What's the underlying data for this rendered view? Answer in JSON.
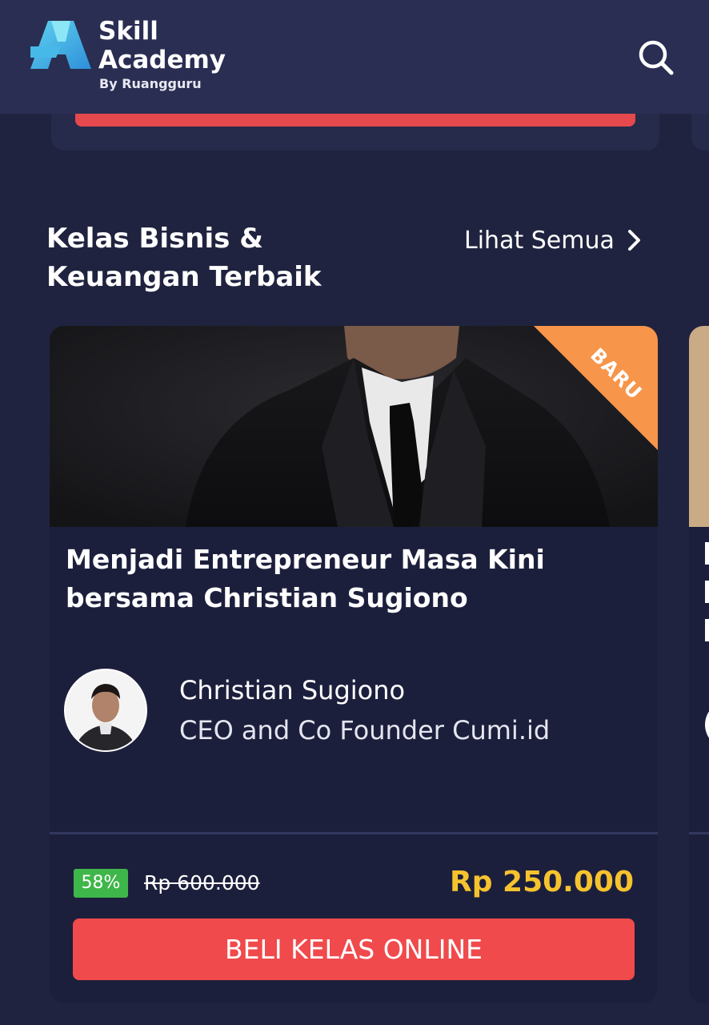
{
  "header": {
    "brand_line1": "Skill",
    "brand_line2": "Academy",
    "brand_by": "By Ruangguru",
    "search_icon": "search-icon"
  },
  "section": {
    "title": "Kelas Bisnis & Keuangan Terbaik",
    "see_all_label": "Lihat Semua",
    "see_all_icon": "chevron-right-icon"
  },
  "course": {
    "badge": "BARU",
    "title": "Menjadi Entrepreneur Masa Kini bersama Christian Sugiono",
    "instructor_name": "Christian Sugiono",
    "instructor_role": "CEO and Co Founder Cumi.id",
    "discount": "58%",
    "original_price": "Rp 600.000",
    "price": "Rp 250.000",
    "buy_label": "BELI KELAS ONLINE"
  },
  "colors": {
    "background": "#20233f",
    "header": "#2a2e52",
    "card": "#1c1f3c",
    "accent_red": "#f04a4c",
    "price_yellow": "#f6c32e",
    "discount_green": "#3fb64a",
    "ribbon_orange": "#f7954a"
  }
}
